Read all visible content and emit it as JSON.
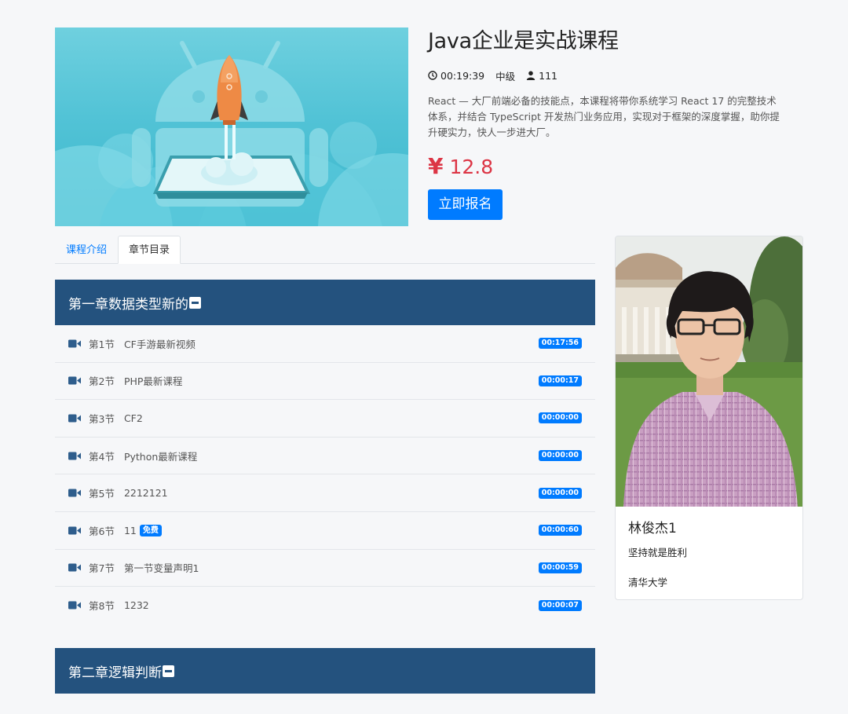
{
  "course": {
    "title": "Java企业是实战课程",
    "duration": "00:19:39",
    "level": "中级",
    "students": "111",
    "description": "React — 大厂前端必备的技能点，本课程将带你系统学习 React 17 的完整技术体系，并结合 TypeScript 开发热门业务应用，实现对于框架的深度掌握，助你提升硬实力，快人一步进大厂。",
    "price_symbol": "¥",
    "price": "12.8",
    "enroll_label": "立即报名"
  },
  "tabs": [
    {
      "label": "课程介绍",
      "active": false
    },
    {
      "label": "章节目录",
      "active": true
    }
  ],
  "chapters": [
    {
      "title": "第一章数据类型新的",
      "lessons": [
        {
          "num": "第1节",
          "name": "CF手游最新视频",
          "free": "",
          "duration": "00:17:56"
        },
        {
          "num": "第2节",
          "name": "PHP最新课程",
          "free": "",
          "duration": "00:00:17"
        },
        {
          "num": "第3节",
          "name": "CF2",
          "free": "",
          "duration": "00:00:00"
        },
        {
          "num": "第4节",
          "name": "Python最新课程",
          "free": "",
          "duration": "00:00:00"
        },
        {
          "num": "第5节",
          "name": "2212121",
          "free": "",
          "duration": "00:00:00"
        },
        {
          "num": "第6节",
          "name": "11",
          "free": "免费",
          "duration": "00:00:60"
        },
        {
          "num": "第7节",
          "name": "第一节变量声明1",
          "free": "",
          "duration": "00:00:59"
        },
        {
          "num": "第8节",
          "name": "1232",
          "free": "",
          "duration": "00:00:07"
        }
      ]
    },
    {
      "title": "第二章逻辑判断",
      "lessons": []
    }
  ],
  "teacher": {
    "name": "林俊杰1",
    "motto": "坚持就是胜利",
    "school": "清华大学"
  },
  "colors": {
    "accent": "#007bff",
    "price": "#dc3545",
    "chapter_bg": "#24527e",
    "page_bg": "#f6f7f9"
  },
  "icons": [
    "clock-icon",
    "user-icon",
    "video-camera-icon",
    "minus-square-icon"
  ]
}
